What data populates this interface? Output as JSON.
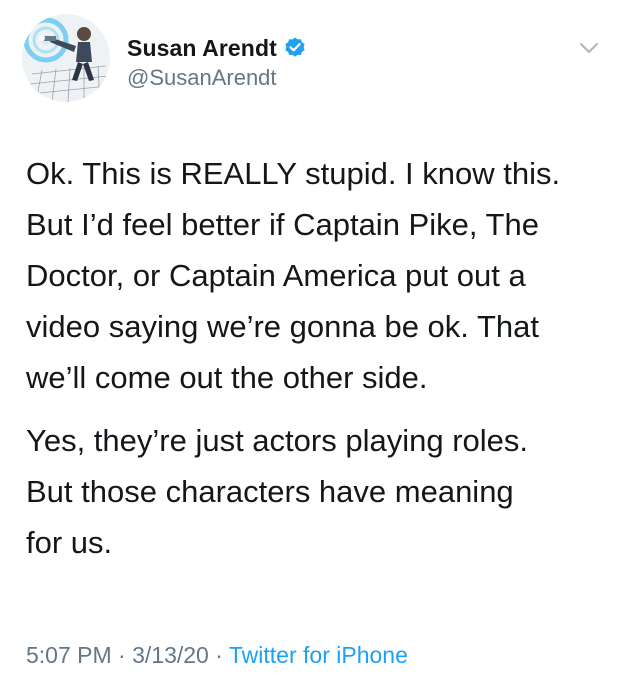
{
  "author": {
    "display_name": "Susan Arendt",
    "handle": "@SusanArendt",
    "verified": true,
    "avatar_icon": "avatar-illustration-icon"
  },
  "tweet": {
    "paragraphs": [
      "Ok. This is REALLY stupid. I know this.\nBut I’d feel better if Captain Pike, The\nDoctor, or Captain America put out a\nvideo saying we’re gonna be ok. That\nwe’ll come out the other side.",
      "Yes, they’re just actors playing roles.\nBut those characters have meaning\nfor us."
    ]
  },
  "meta": {
    "time": "5:07 PM",
    "separator": "·",
    "date": "3/13/20",
    "source": "Twitter for iPhone"
  },
  "colors": {
    "text": "#14171a",
    "secondary": "#657786",
    "link": "#1da1f2",
    "verified": "#1da1f2"
  },
  "icons": {
    "verified": "verified-badge-icon",
    "menu": "chevron-down-icon"
  }
}
